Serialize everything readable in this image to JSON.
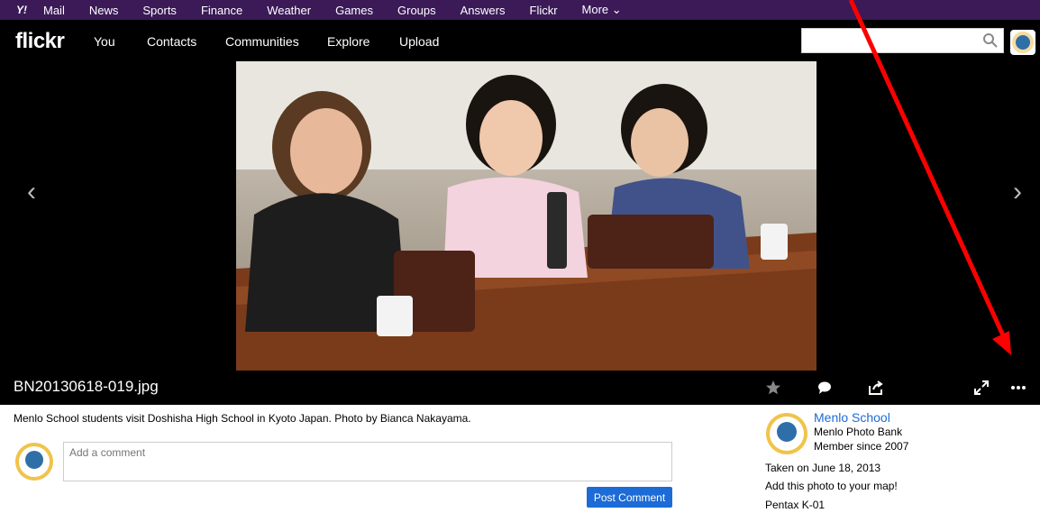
{
  "yahoo_bar": {
    "items": [
      "Mail",
      "News",
      "Sports",
      "Finance",
      "Weather",
      "Games",
      "Groups",
      "Answers",
      "Flickr",
      "More ⌄"
    ]
  },
  "flickr_nav": {
    "logo": "flickr",
    "items": [
      "You",
      "Contacts",
      "Communities",
      "Explore",
      "Upload"
    ],
    "search_placeholder": ""
  },
  "photo": {
    "title": "BN20130618-019.jpg",
    "description": "Menlo School students visit Doshisha High School in Kyoto Japan. Photo by Bianca Nakayama."
  },
  "comment": {
    "placeholder": "Add a comment",
    "post_label": "Post Comment"
  },
  "owner": {
    "name": "Menlo School",
    "subtitle": "Menlo Photo Bank",
    "member_since": "Member since 2007"
  },
  "meta": {
    "taken": "Taken on June 18, 2013",
    "add_map": "Add this photo to your map!",
    "camera": "Pentax K-01"
  },
  "colors": {
    "yahoo_purple": "#3b1a57",
    "flickr_blue": "#1c6bd6",
    "annotation_red": "#ff0000"
  },
  "icons": [
    "yahoo-logo-icon",
    "search-icon",
    "prev-arrow-icon",
    "next-arrow-icon",
    "star-icon",
    "comment-icon",
    "share-icon",
    "expand-icon",
    "more-icon"
  ]
}
